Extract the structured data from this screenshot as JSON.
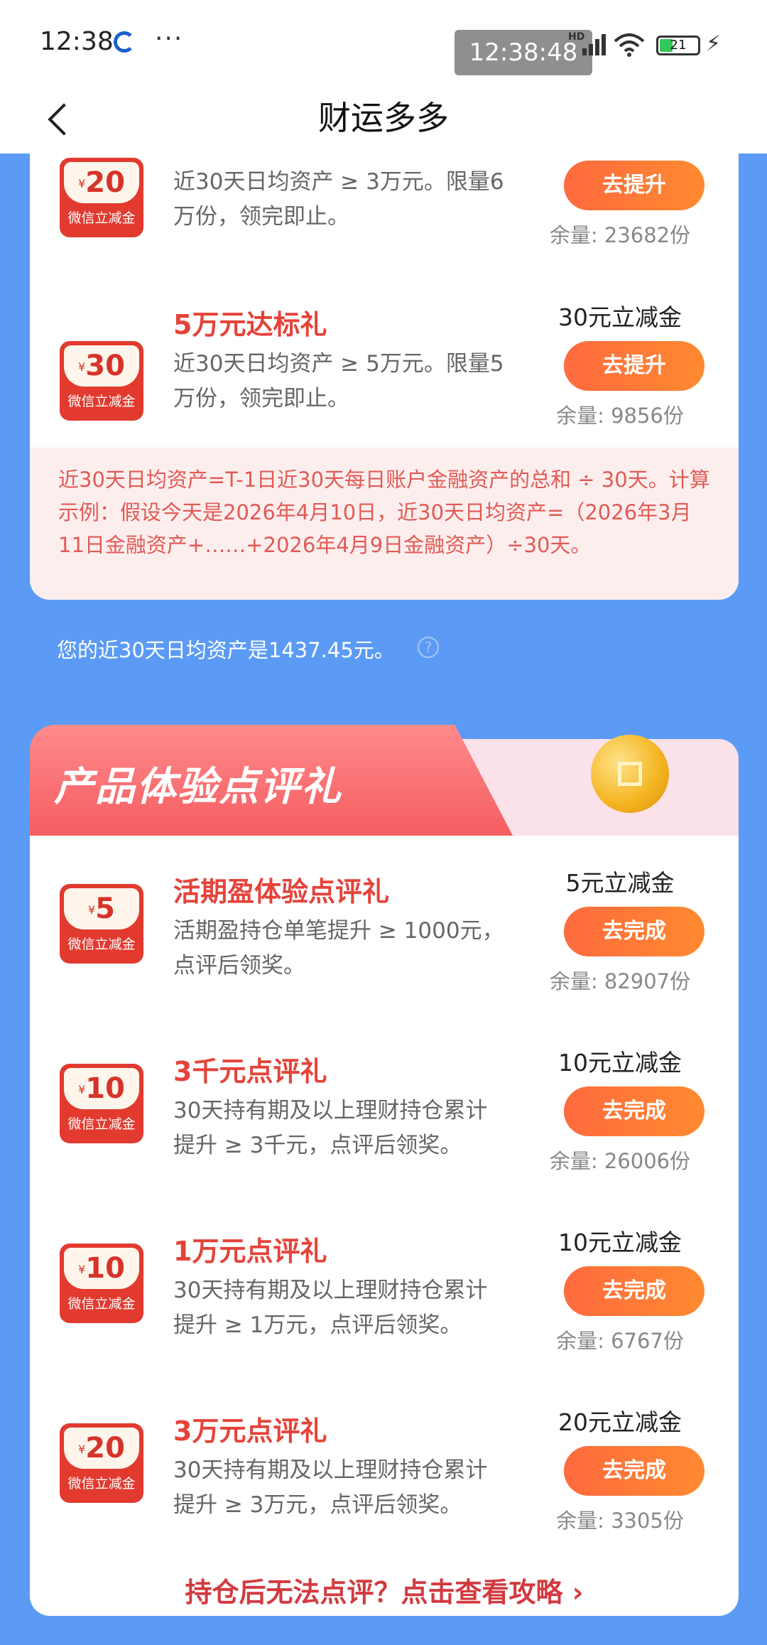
{
  "status": {
    "time": "12:38",
    "dots": "···",
    "clock": "12:38:48",
    "hd": "HD",
    "battery": "21"
  },
  "nav": {
    "title": "财运多多"
  },
  "section1": {
    "items": [
      {
        "coupon_amount": "20",
        "coupon_symbol": "¥",
        "coupon_label": "微信立减金",
        "desc_line1": "近30天日均资产 ≥ 3万元。限量6",
        "desc_line2": "万份，领完即止。",
        "button": "去提升",
        "remain": "余量: 23682份"
      },
      {
        "coupon_amount": "30",
        "coupon_symbol": "¥",
        "coupon_label": "微信立减金",
        "title": "5万元达标礼",
        "desc_line1": "近30天日均资产 ≥ 5万元。限量5",
        "desc_line2": "万份，领完即止。",
        "prize": "30元立减金",
        "button": "去提升",
        "remain": "余量: 9856份"
      }
    ],
    "note": "近30天日均资产=T-1日近30天每日账户金融资产的总和 ÷ 30天。计算示例：假设今天是2026年4月10日，近30天日均资产=（2026年3月11日金融资产+……+2026年4月9日金融资产）÷30天。"
  },
  "my_asset": "您的近30天日均资产是1437.45元。",
  "section2": {
    "banner_title": "产品体验点评礼",
    "items": [
      {
        "coupon_amount": "5",
        "coupon_symbol": "¥",
        "coupon_label": "微信立减金",
        "title": "活期盈体验点评礼",
        "desc_line1": "活期盈持仓单笔提升 ≥ 1000元，",
        "desc_line2": "点评后领奖。",
        "prize": "5元立减金",
        "button": "去完成",
        "remain": "余量: 82907份"
      },
      {
        "coupon_amount": "10",
        "coupon_symbol": "¥",
        "coupon_label": "微信立减金",
        "title": "3千元点评礼",
        "desc_line1": "30天持有期及以上理财持仓累计",
        "desc_line2": "提升 ≥ 3千元，点评后领奖。",
        "prize": "10元立减金",
        "button": "去完成",
        "remain": "余量: 26006份"
      },
      {
        "coupon_amount": "10",
        "coupon_symbol": "¥",
        "coupon_label": "微信立减金",
        "title": "1万元点评礼",
        "desc_line1": "30天持有期及以上理财持仓累计",
        "desc_line2": "提升 ≥ 1万元，点评后领奖。",
        "prize": "10元立减金",
        "button": "去完成",
        "remain": "余量: 6767份"
      },
      {
        "coupon_amount": "20",
        "coupon_symbol": "¥",
        "coupon_label": "微信立减金",
        "title": "3万元点评礼",
        "desc_line1": "30天持有期及以上理财持仓累计",
        "desc_line2": "提升 ≥ 3万元，点评后领奖。",
        "prize": "20元立减金",
        "button": "去完成",
        "remain": "余量: 3305份"
      }
    ],
    "bottom_link": "持仓后无法点评？点击查看攻略 ›"
  }
}
